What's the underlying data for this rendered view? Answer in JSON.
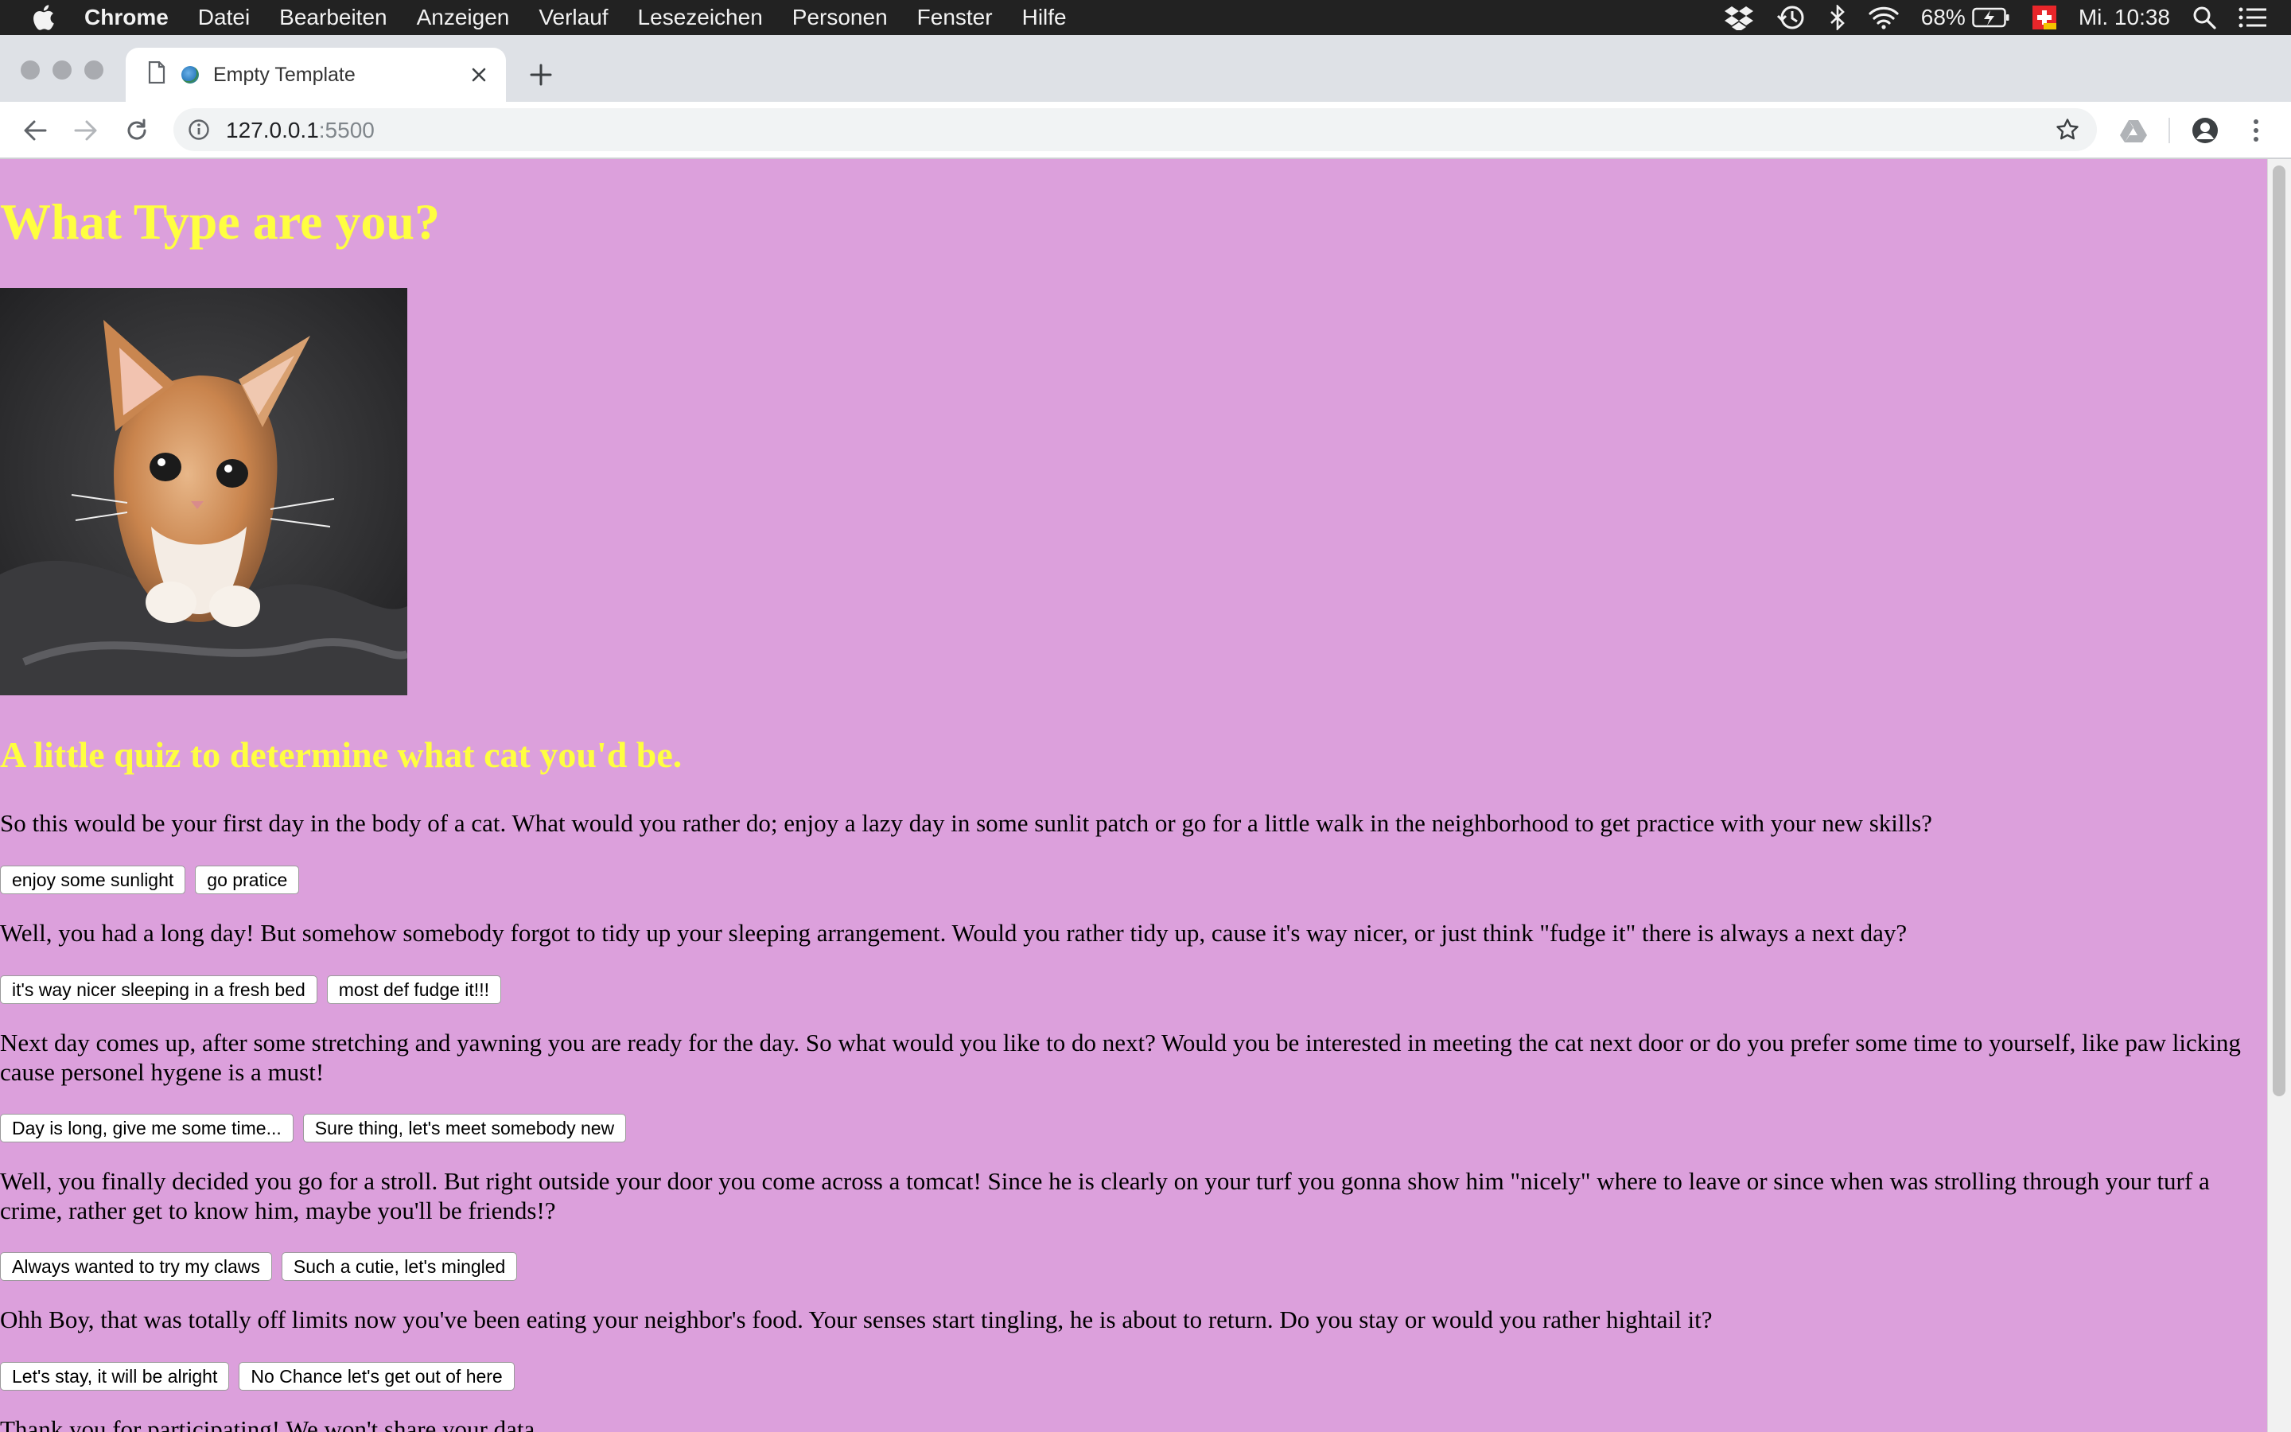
{
  "menubar": {
    "app_name": "Chrome",
    "menus": [
      "Datei",
      "Bearbeiten",
      "Anzeigen",
      "Verlauf",
      "Lesezeichen",
      "Personen",
      "Fenster",
      "Hilfe"
    ],
    "battery": "68%",
    "clock": "Mi. 10:38"
  },
  "browser": {
    "tab_title": "Empty Template",
    "url_host": "127.0.0.1",
    "url_port": ":5500"
  },
  "page": {
    "title": "What Type are you?",
    "subtitle": "A little quiz to determine what cat you'd be.",
    "questions": [
      {
        "text": "So this would be your first day in the body of a cat. What would you rather do; enjoy a lazy day in some sunlit patch or go for a little walk in the neighborhood to get practice with your new skills?",
        "options": [
          "enjoy some sunlight",
          "go pratice"
        ]
      },
      {
        "text": "Well, you had a long day! But somehow somebody forgot to tidy up your sleeping arrangement. Would you rather tidy up, cause it's way nicer, or just think \"fudge it\" there is always a next day?",
        "options": [
          "it's way nicer sleeping in a fresh bed",
          "most def fudge it!!!"
        ]
      },
      {
        "text": "Next day comes up, after some stretching and yawning you are ready for the day. So what would you like to do next? Would you be interested in meeting the cat next door or do you prefer some time to yourself, like paw licking cause personel hygene is a must!",
        "options": [
          "Day is long, give me some time...",
          "Sure thing, let's meet somebody new"
        ]
      },
      {
        "text": "Well, you finally decided you go for a stroll. But right outside your door you come across a tomcat! Since he is clearly on your turf you gonna show him \"nicely\" where to leave or since when was strolling through your turf a crime, rather get to know him, maybe you'll be friends!?",
        "options": [
          "Always wanted to try my claws",
          "Such a cutie, let's mingled"
        ]
      },
      {
        "text": "Ohh Boy, that was totally off limits now you've been eating your neighbor's food. Your senses start tingling, he is about to return. Do you stay or would you rather hightail it?",
        "options": [
          "Let's stay, it will be alright",
          "No Chance let's get out of here"
        ]
      }
    ],
    "closing": "Thank you for participating! We won't share your data."
  }
}
